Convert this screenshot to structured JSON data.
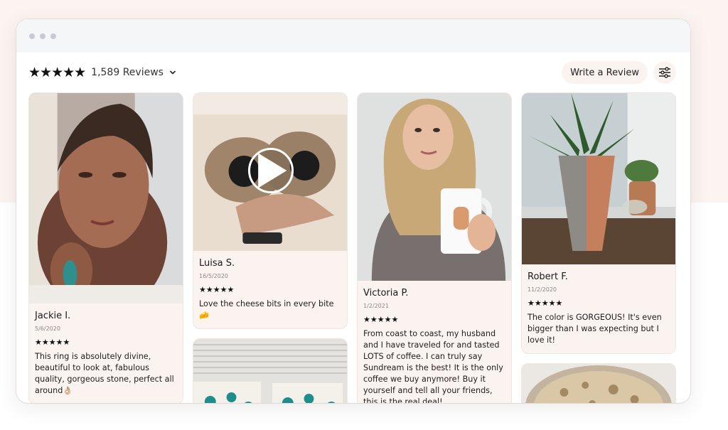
{
  "header": {
    "stars": "★★★★★",
    "review_count": "1,589 Reviews",
    "write_review": "Write a Review"
  },
  "icons": {
    "summary_stars": "five-star-icon",
    "dropdown": "chevron-down-icon",
    "filter": "sliders-icon",
    "video": "play-icon"
  },
  "reviews": [
    {
      "name": "Jackie I.",
      "date": "5/6/2020",
      "stars": "★★★★★",
      "text": "This ring is absolutely divine, beautiful to look at, fabulous quality, gorgeous stone, perfect all around👌🏼"
    },
    {
      "name": "Luisa S.",
      "date": "16/5/2020",
      "stars": "★★★★★",
      "text": "Love the cheese bits in every bite 🧀"
    },
    {
      "name": "Victoria P.",
      "date": "1/2/2021",
      "stars": "★★★★★",
      "text": "From coast to coast, my husband and I have traveled for and tasted LOTS of coffee. I can truly say Sundream is the best! It is the only coffee we buy anymore! Buy it yourself and tell all your friends, this is the real deal!"
    },
    {
      "name": "Robert F.",
      "date": "11/2/2020",
      "stars": "★★★★★",
      "text": "The color is GORGEOUS! It's even bigger than I was expecting but I love it!"
    }
  ],
  "colors": {
    "card_bg": "#fbf3f0",
    "page_tint": "#fcf4f1"
  }
}
